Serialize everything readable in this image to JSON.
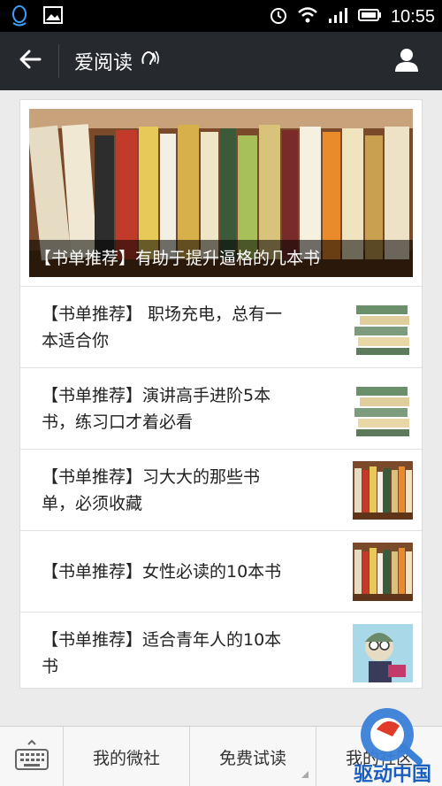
{
  "status_bar": {
    "time": "10:55",
    "icons": [
      "qq-icon",
      "image-notification-icon",
      "alarm-icon",
      "wifi-icon",
      "signal-icon",
      "battery-icon"
    ]
  },
  "nav": {
    "title": "爱阅读",
    "icons": [
      "back-arrow-icon",
      "voice-listen-icon",
      "profile-icon"
    ]
  },
  "feature": {
    "caption": "【书单推荐】有助于提升逼格的几本书"
  },
  "articles": [
    {
      "line1": "【书单推荐】 职场充电，总有一",
      "line2": "本适合你",
      "thumb": "book-stack"
    },
    {
      "line1": "【书单推荐】演讲高手进阶5本",
      "line2": "书，练习口才着必看",
      "thumb": "book-stack"
    },
    {
      "line1": "【书单推荐】习大大的那些书",
      "line2": "单，必须收藏",
      "thumb": "bookshelf"
    },
    {
      "line1": "【书单推荐】女性必读的10本书",
      "line2": "",
      "thumb": "bookshelf"
    },
    {
      "line1": "【书单推荐】适合青年人的10本",
      "line2": "书",
      "thumb": "cartoon"
    }
  ],
  "bottom_menu": {
    "tabs": [
      {
        "label": "我的微社"
      },
      {
        "label": "免费试读"
      },
      {
        "label": "我的社区"
      }
    ]
  },
  "watermark": {
    "text": "驱动中国"
  },
  "colors": {
    "nav_bg": "#262a2f",
    "status_bg": "#000000",
    "page_bg": "#ebebeb"
  }
}
